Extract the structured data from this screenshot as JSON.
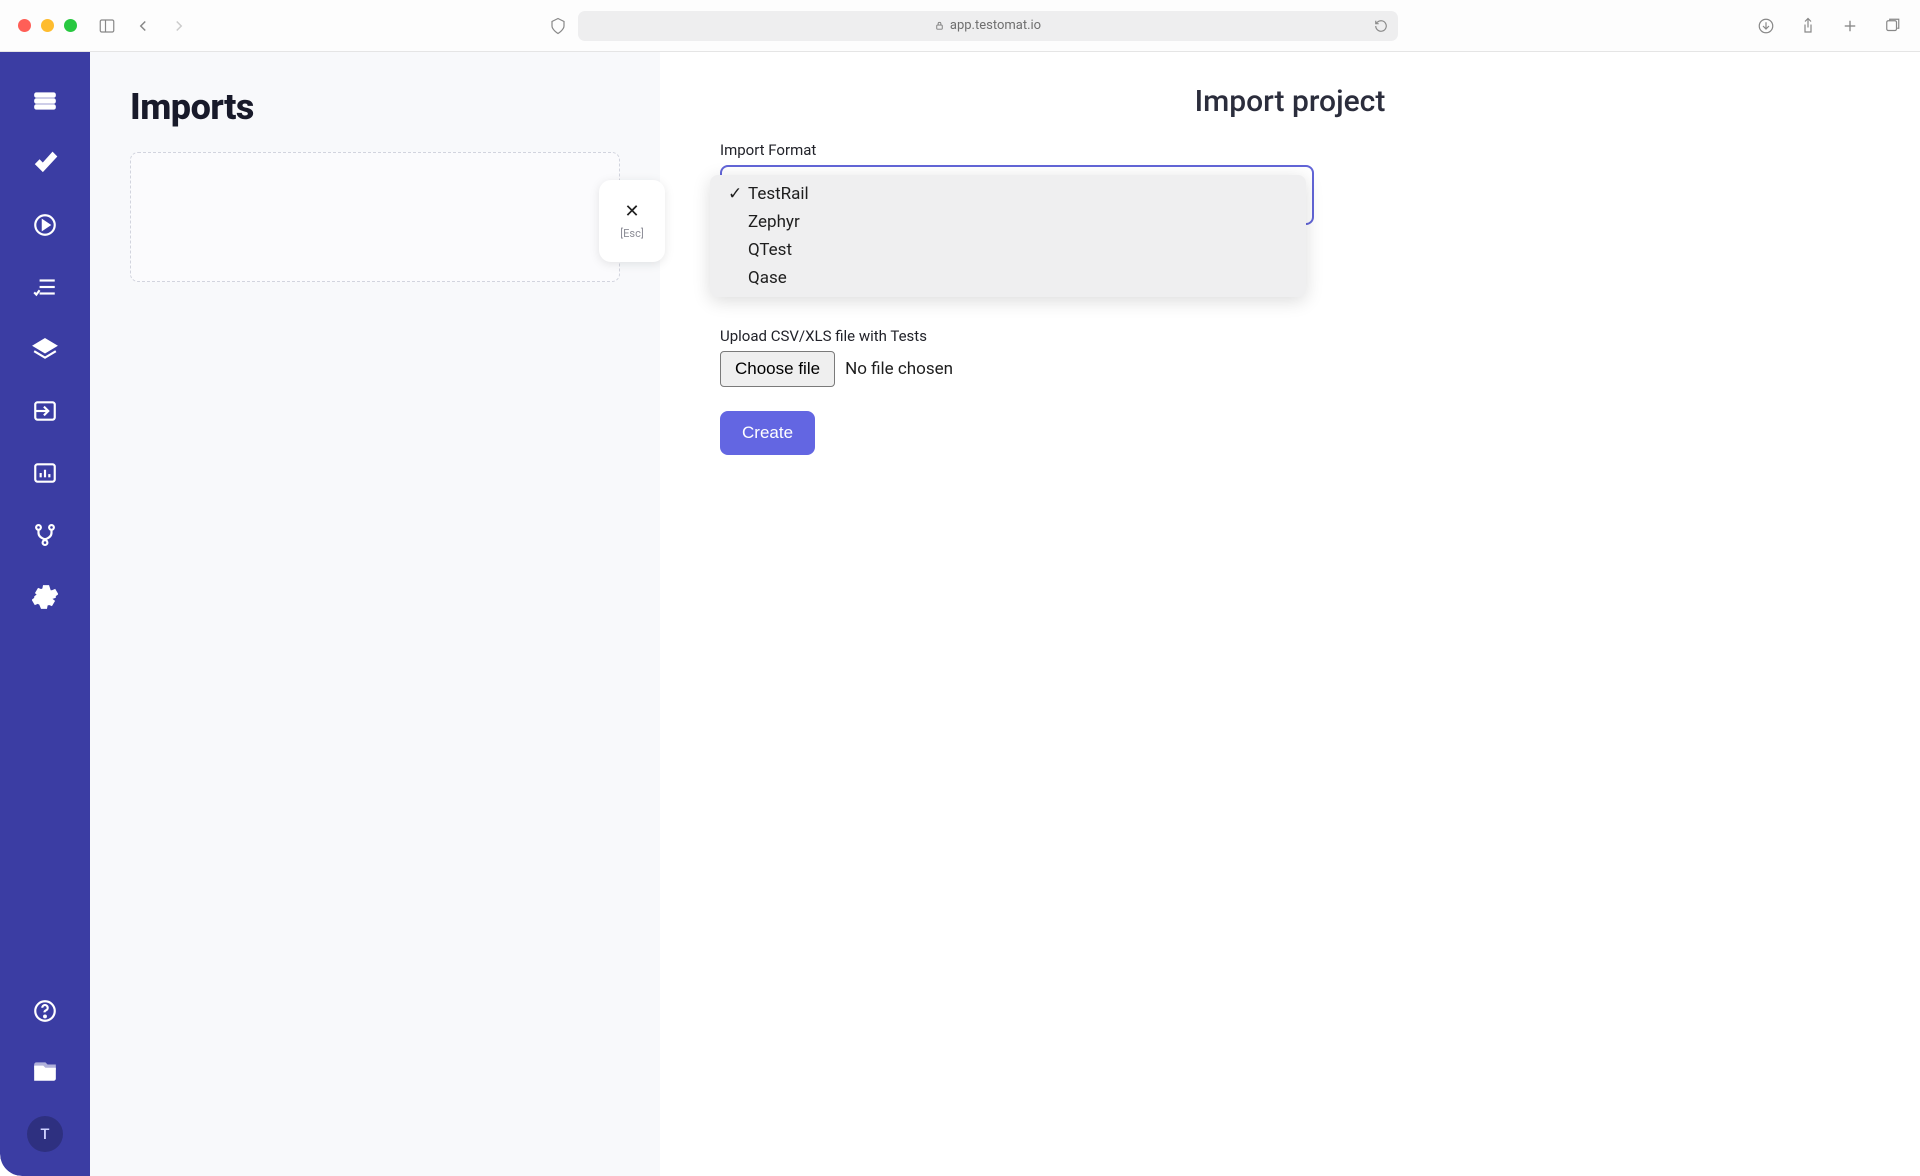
{
  "browser": {
    "url_display": "app.testomat.io"
  },
  "page": {
    "title": "Imports"
  },
  "close": {
    "esc_label": "[Esc]"
  },
  "modal": {
    "title": "Import project",
    "format_label": "Import Format",
    "options": [
      {
        "label": "TestRail",
        "selected": true
      },
      {
        "label": "Zephyr",
        "selected": false
      },
      {
        "label": "QTest",
        "selected": false
      },
      {
        "label": "Qase",
        "selected": false
      }
    ],
    "upload_label": "Upload CSV/XLS file with Tests",
    "choose_file_label": "Choose file",
    "no_file_label": "No file chosen",
    "create_label": "Create"
  },
  "avatar": {
    "initial": "T"
  }
}
